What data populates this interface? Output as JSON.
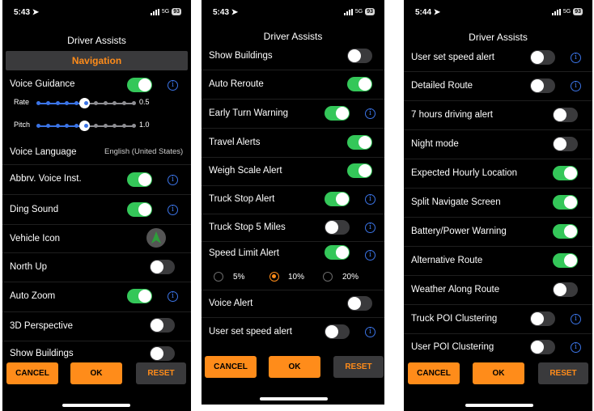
{
  "screen1": {
    "time": "5:43",
    "network": "5G",
    "battery": "93",
    "title": "Driver Assists",
    "section": "Navigation",
    "voice_guidance": "Voice Guidance",
    "rate_label": "Rate",
    "rate_value": "0.5",
    "pitch_label": "Pitch",
    "pitch_value": "1.0",
    "voice_language_label": "Voice Language",
    "voice_language_value": "English (United States)",
    "abbrv": "Abbrv. Voice Inst.",
    "ding": "Ding Sound",
    "vehicle_icon": "Vehicle Icon",
    "north_up": "North Up",
    "auto_zoom": "Auto Zoom",
    "perspective": "3D Perspective",
    "show_buildings": "Show Buildings",
    "cancel": "CANCEL",
    "ok": "OK",
    "reset": "RESET"
  },
  "screen2": {
    "time": "5:43",
    "network": "5G",
    "battery": "93",
    "title": "Driver Assists",
    "show_buildings": "Show Buildings",
    "auto_reroute": "Auto Reroute",
    "early_turn": "Early Turn Warning",
    "travel_alerts": "Travel Alerts",
    "weigh_scale": "Weigh Scale Alert",
    "truck_stop": "Truck Stop Alert",
    "truck_stop_5": "Truck Stop 5 Miles",
    "speed_limit": "Speed Limit Alert",
    "opt_5": "5%",
    "opt_10": "10%",
    "opt_20": "20%",
    "voice_alert": "Voice Alert",
    "user_speed": "User set speed alert",
    "cancel": "CANCEL",
    "ok": "OK",
    "reset": "RESET"
  },
  "screen3": {
    "time": "5:44",
    "network": "5G",
    "battery": "93",
    "title": "Driver Assists",
    "user_speed": "User set speed alert",
    "detailed_route": "Detailed Route",
    "seven_hours": "7 hours driving alert",
    "night_mode": "Night mode",
    "expected_hourly": "Expected Hourly Location",
    "split_navigate": "Split Navigate Screen",
    "battery_power": "Battery/Power Warning",
    "alt_route": "Alternative Route",
    "weather": "Weather Along Route",
    "truck_poi": "Truck POI Clustering",
    "user_poi": "User POI Clustering",
    "cancel": "CANCEL",
    "ok": "OK",
    "reset": "RESET"
  },
  "colors": {
    "toggle_on": "#34c759",
    "accent": "#ff8c1a",
    "info": "#3b74e6",
    "background": "#000000"
  },
  "icons": {
    "info": "info-icon",
    "vehicle": "navigation-arrow-icon",
    "location": "location-arrow-icon"
  },
  "settings": {
    "rate_fraction": 0.5,
    "pitch_fraction": 0.5,
    "speed_limit_selected": "10%"
  }
}
